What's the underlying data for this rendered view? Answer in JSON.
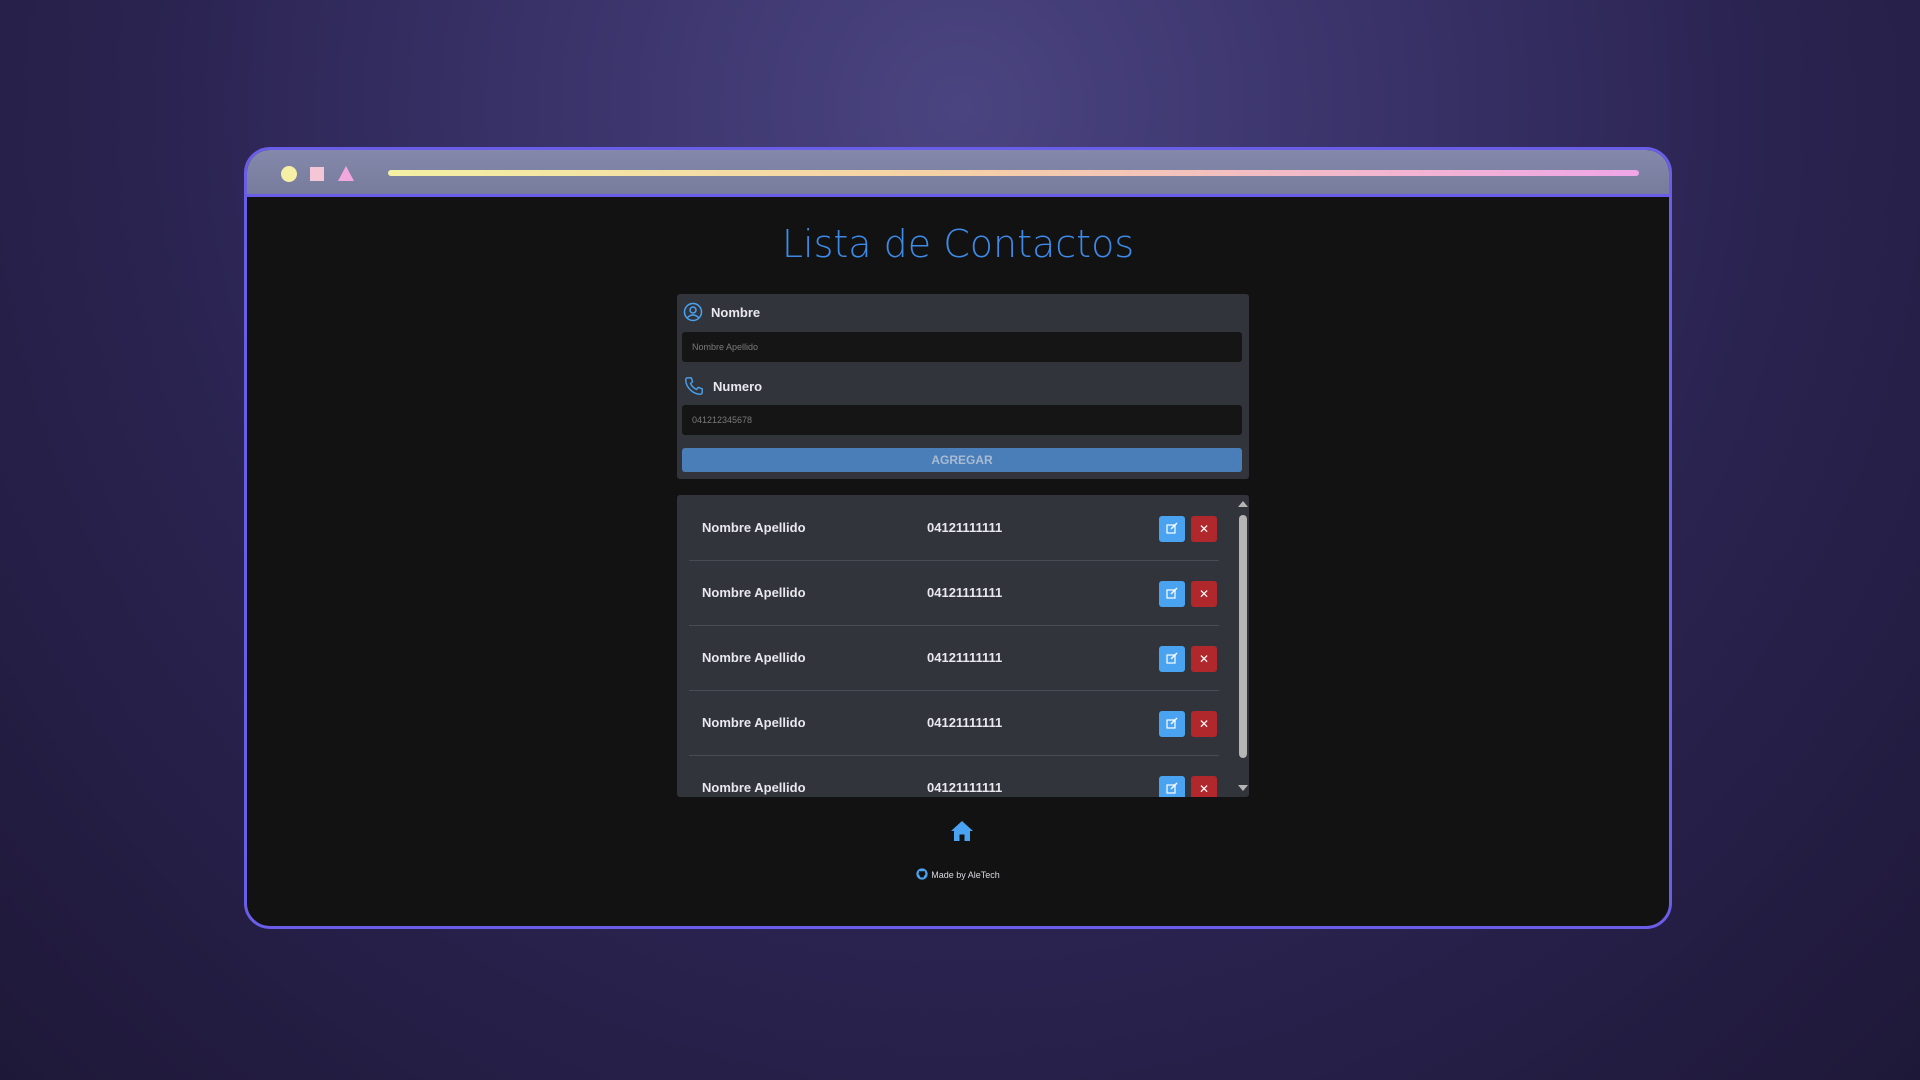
{
  "window": {
    "controls": [
      "circle-control",
      "square-control",
      "triangle-control"
    ]
  },
  "page": {
    "title": "Lista de Contactos"
  },
  "form": {
    "name_label": "Nombre",
    "name_placeholder": "Nombre Apellido",
    "number_label": "Numero",
    "number_placeholder": "041212345678",
    "add_button": "AGREGAR"
  },
  "contacts": [
    {
      "name": "Nombre Apellido",
      "number": "04121111111"
    },
    {
      "name": "Nombre Apellido",
      "number": "04121111111"
    },
    {
      "name": "Nombre Apellido",
      "number": "04121111111"
    },
    {
      "name": "Nombre Apellido",
      "number": "04121111111"
    },
    {
      "name": "Nombre Apellido",
      "number": "04121111111"
    }
  ],
  "actions": {
    "delete_glyph": "✕"
  },
  "footer": {
    "credit": "Made by AleTech"
  },
  "colors": {
    "accent": "#3d8ae8",
    "edit": "#4aa3f0",
    "delete": "#b0282c",
    "frame": "#6a5ee8"
  }
}
